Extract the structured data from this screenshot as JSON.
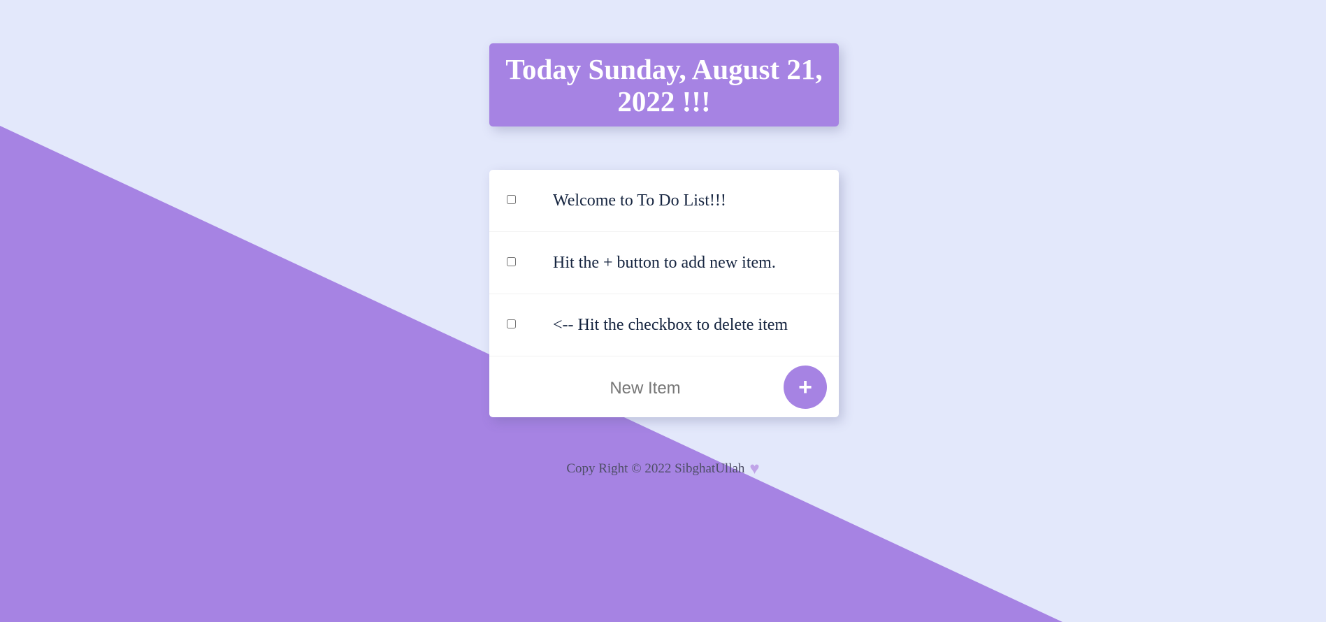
{
  "header": {
    "title": "Today Sunday, August 21, 2022 !!!"
  },
  "todo": {
    "items": [
      {
        "label": "Welcome to To Do List!!!",
        "checked": false
      },
      {
        "label": "Hit the + button to add new item.",
        "checked": false
      },
      {
        "label": "<-- Hit the checkbox to delete item",
        "checked": false
      }
    ],
    "new_item_placeholder": "New Item",
    "new_item_value": "",
    "add_button_label": "+"
  },
  "footer": {
    "text": "Copy Right © 2022 SibghatUllah",
    "icon": "heart-icon"
  },
  "colors": {
    "background": "#e3e8fb",
    "accent": "#a683e3",
    "card": "#ffffff",
    "item_text": "#15243f"
  }
}
